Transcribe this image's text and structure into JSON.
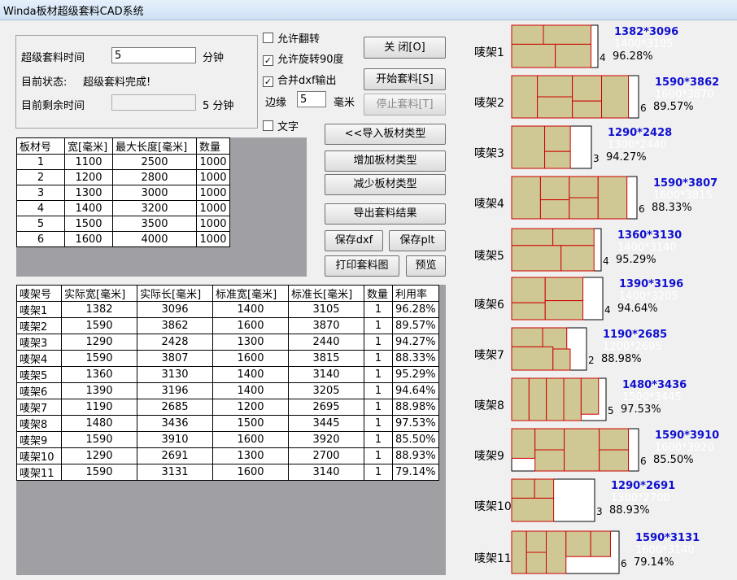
{
  "window": {
    "title": "Winda板材超级套料CAD系统"
  },
  "settings": {
    "time_label": "超级套料时间",
    "time_value": "5",
    "time_unit": "分钟",
    "status_label": "目前状态:",
    "status_value": "超级套料完成!",
    "remain_label": "目前剩余时间",
    "remain_value": "",
    "remain_unit": "5 分钟"
  },
  "options": {
    "allow_flip": "允许翻转",
    "allow_rotate": "允许旋转90度",
    "merge_dxf": "合并dxf输出",
    "margin_label": "边缘",
    "margin_value": "5",
    "margin_unit": "毫米",
    "text": "文字",
    "check_mark": "✓"
  },
  "buttons": {
    "close": "关  闭[O]",
    "start": "开始套料[S]",
    "stop": "停止套料[T]",
    "import": "<<导入板材类型",
    "add": "增加板材类型",
    "remove": "减少板材类型",
    "export": "导出套料结果",
    "save_dxf": "保存dxf",
    "save_plt": "保存plt",
    "print": "打印套料图",
    "preview": "预览"
  },
  "plate_table": {
    "headers": [
      "板材号",
      "宽[毫米]",
      "最大长度[毫米]",
      "数量"
    ],
    "rows": [
      [
        "1",
        "1100",
        "2500",
        "1000"
      ],
      [
        "2",
        "1200",
        "2800",
        "1000"
      ],
      [
        "3",
        "1300",
        "3000",
        "1000"
      ],
      [
        "4",
        "1400",
        "3200",
        "1000"
      ],
      [
        "5",
        "1500",
        "3500",
        "1000"
      ],
      [
        "6",
        "1600",
        "4000",
        "1000"
      ]
    ]
  },
  "result_table": {
    "headers": [
      "唛架号",
      "实际宽[毫米]",
      "实际长[毫米]",
      "标准宽[毫米]",
      "标准长[毫米]",
      "数量",
      "利用率"
    ],
    "rows": [
      [
        "唛架1",
        "1382",
        "3096",
        "1400",
        "3105",
        "1",
        "96.28%"
      ],
      [
        "唛架2",
        "1590",
        "3862",
        "1600",
        "3870",
        "1",
        "89.57%"
      ],
      [
        "唛架3",
        "1290",
        "2428",
        "1300",
        "2440",
        "1",
        "94.27%"
      ],
      [
        "唛架4",
        "1590",
        "3807",
        "1600",
        "3815",
        "1",
        "88.33%"
      ],
      [
        "唛架5",
        "1360",
        "3130",
        "1400",
        "3140",
        "1",
        "95.29%"
      ],
      [
        "唛架6",
        "1390",
        "3196",
        "1400",
        "3205",
        "1",
        "94.64%"
      ],
      [
        "唛架7",
        "1190",
        "2685",
        "1200",
        "2695",
        "1",
        "88.98%"
      ],
      [
        "唛架8",
        "1480",
        "3436",
        "1500",
        "3445",
        "1",
        "97.53%"
      ],
      [
        "唛架9",
        "1590",
        "3910",
        "1600",
        "3920",
        "1",
        "85.50%"
      ],
      [
        "唛架10",
        "1290",
        "2691",
        "1300",
        "2700",
        "1",
        "88.93%"
      ],
      [
        "唛架11",
        "1590",
        "3131",
        "1600",
        "3140",
        "1",
        "79.14%"
      ]
    ]
  },
  "markers": [
    {
      "name": "唛架1",
      "actual": "1382*3096",
      "standard": "1400*3105",
      "count": "4",
      "util": "96.28%"
    },
    {
      "name": "唛架2",
      "actual": "1590*3862",
      "standard": "1600*3870",
      "count": "6",
      "util": "89.57%"
    },
    {
      "name": "唛架3",
      "actual": "1290*2428",
      "standard": "1300*2440",
      "count": "3",
      "util": "94.27%"
    },
    {
      "name": "唛架4",
      "actual": "1590*3807",
      "standard": "1600*3815",
      "count": "6",
      "util": "88.33%"
    },
    {
      "name": "唛架5",
      "actual": "1360*3130",
      "standard": "1400*3140",
      "count": "4",
      "util": "95.29%"
    },
    {
      "name": "唛架6",
      "actual": "1390*3196",
      "standard": "1400*3205",
      "count": "4",
      "util": "94.64%"
    },
    {
      "name": "唛架7",
      "actual": "1190*2685",
      "standard": "1200*2695",
      "count": "2",
      "util": "88.98%"
    },
    {
      "name": "唛架8",
      "actual": "1480*3436",
      "standard": "1500*3445",
      "count": "5",
      "util": "97.53%"
    },
    {
      "name": "唛架9",
      "actual": "1590*3910",
      "standard": "1600*3920",
      "count": "6",
      "util": "85.50%"
    },
    {
      "name": "唛架10",
      "actual": "1290*2691",
      "standard": "1300*2700",
      "count": "3",
      "util": "88.93%"
    },
    {
      "name": "唛架11",
      "actual": "1590*3131",
      "standard": "1600*3140",
      "count": "6",
      "util": "79.14%"
    }
  ],
  "colors": {
    "piece_fill": "#cfc894",
    "piece_stroke": "#cc0000",
    "actual_text": "#1010d0",
    "grid_bg": "#a0a0a4"
  }
}
